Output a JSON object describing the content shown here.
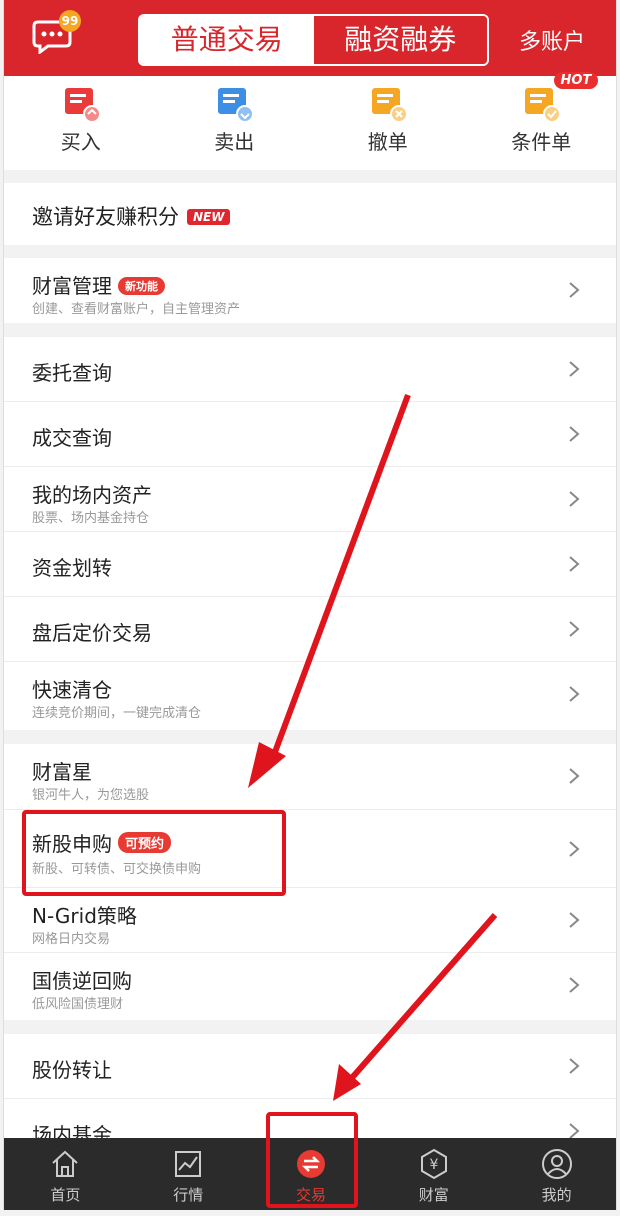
{
  "header": {
    "badge": "99",
    "tabs": [
      {
        "label": "普通交易",
        "active": true
      },
      {
        "label": "融资融券",
        "active": false
      }
    ],
    "multi_account": "多账户",
    "brand_color": "#d8262c"
  },
  "quick_actions": [
    {
      "label": "买入",
      "icon": "buy-icon"
    },
    {
      "label": "卖出",
      "icon": "sell-icon"
    },
    {
      "label": "撤单",
      "icon": "cancel-order-icon"
    },
    {
      "label": "条件单",
      "icon": "conditional-order-icon",
      "badge": "HOT"
    }
  ],
  "invite": {
    "title": "邀请好友赚积分",
    "badge": "NEW"
  },
  "wealth_mgmt": {
    "title": "财富管理",
    "badge": "新功能",
    "subtitle": "创建、查看财富账户，自主管理资产"
  },
  "group1": [
    {
      "title": "委托查询",
      "subtitle": ""
    },
    {
      "title": "成交查询",
      "subtitle": ""
    },
    {
      "title": "我的场内资产",
      "subtitle": "股票、场内基金持仓"
    },
    {
      "title": "资金划转",
      "subtitle": ""
    },
    {
      "title": "盘后定价交易",
      "subtitle": ""
    },
    {
      "title": "快速清仓",
      "subtitle": "连续竞价期间，一键完成清仓"
    }
  ],
  "group2": [
    {
      "title": "财富星",
      "subtitle": "银河牛人，为您选股"
    },
    {
      "title": "新股申购",
      "subtitle": "新股、可转债、可交换债申购",
      "badge": "可预约"
    },
    {
      "title": "N-Grid策略",
      "subtitle": "网格日内交易"
    },
    {
      "title": "国债逆回购",
      "subtitle": "低风险国债理财"
    }
  ],
  "group3": [
    {
      "title": "股份转让",
      "subtitle": ""
    },
    {
      "title": "场内基金",
      "subtitle": ""
    }
  ],
  "tabbar": [
    {
      "label": "首页",
      "icon": "home-icon"
    },
    {
      "label": "行情",
      "icon": "chart-icon"
    },
    {
      "label": "交易",
      "icon": "trade-icon",
      "active": true
    },
    {
      "label": "财富",
      "icon": "wealth-icon"
    },
    {
      "label": "我的",
      "icon": "profile-icon"
    }
  ]
}
